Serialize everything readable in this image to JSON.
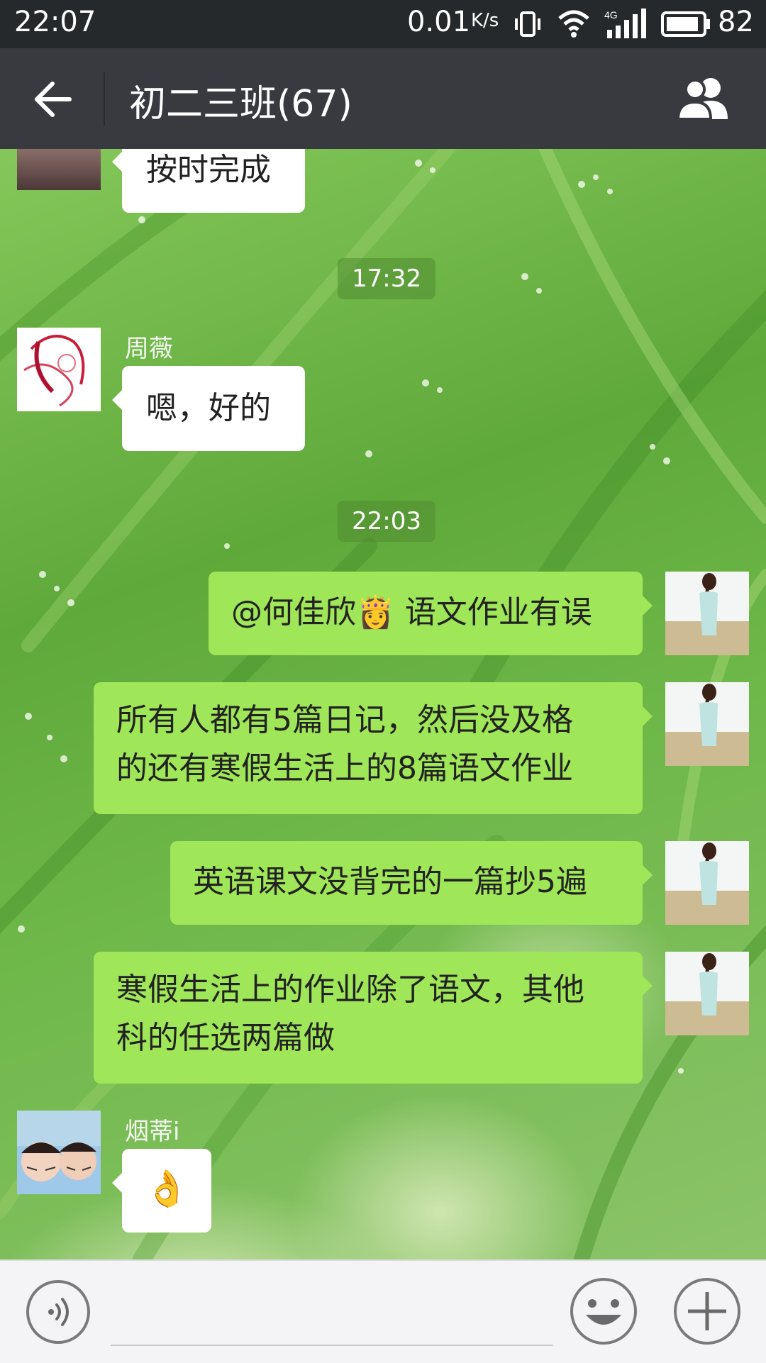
{
  "status_bar": {
    "time": "22:07",
    "network_speed": "0.01",
    "network_speed_unit": "K/s",
    "network_type": "4G",
    "battery": "82"
  },
  "header": {
    "title": "初二三班(67)"
  },
  "chat": {
    "partial_message": "按时完成",
    "timestamp_1": "17:32",
    "msg_zhouwei": {
      "sender": "周薇",
      "text": "嗯，好的"
    },
    "timestamp_2": "22:03",
    "my_messages": [
      {
        "line1": "@何佳欣👸 语文作业有误"
      },
      {
        "line1": "所有人都有5篇日记，然后没及格",
        "line2": "的还有寒假生活上的8篇语文作业"
      },
      {
        "line1": "英语课文没背完的一篇抄5遍"
      },
      {
        "line1": "寒假生活上的作业除了语文，其他",
        "line2": "科的任选两篇做"
      }
    ],
    "msg_yandi": {
      "sender": "烟蒂i",
      "text": "👌"
    }
  },
  "colors": {
    "status_bar": "#26292b",
    "title_bar": "#393a3f",
    "my_bubble": "#9fe658",
    "other_bubble": "#ffffff"
  },
  "icons": {
    "back": "back-arrow-icon",
    "group": "group-members-icon",
    "voice": "voice-icon",
    "emoji": "emoji-icon",
    "plus": "plus-icon"
  }
}
